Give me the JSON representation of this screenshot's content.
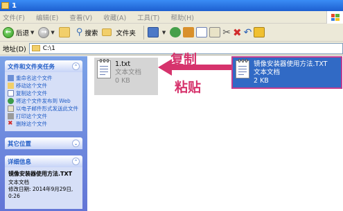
{
  "window": {
    "title": "1"
  },
  "menu": [
    "文件(F)",
    "编辑(E)",
    "查看(V)",
    "收藏(A)",
    "工具(T)",
    "帮助(H)"
  ],
  "toolbar": {
    "back_label": "后退",
    "search_label": "搜索",
    "folders_label": "文件夹"
  },
  "address": {
    "label": "地址(D)",
    "value": "C:\\1"
  },
  "left_pane": {
    "tasks_header": "文件和文件夹任务",
    "tasks": [
      "重命名这个文件",
      "移动这个文件",
      "复制这个文件",
      "将这个文件发布到 Web",
      "以电子邮件形式发送此文件",
      "打印这个文件",
      "删除这个文件"
    ],
    "other_header": "其它位置",
    "details_header": "详细信息",
    "details": {
      "name": "镜像安装器使用方法.TXT",
      "type": "文本文档",
      "modified": "修改日期: 2014年9月29日,",
      "time": "0:26"
    }
  },
  "files": [
    {
      "name": "1.txt",
      "type": "文本文档",
      "size": "0 KB"
    },
    {
      "name": "镜像安装器使用方法.TXT",
      "type": "文本文档",
      "size": "2 KB"
    }
  ],
  "annotations": {
    "copy": "复制",
    "paste": "粘贴"
  },
  "colors": {
    "annotation": "#d6336c",
    "selection": "#316ac5",
    "taskpane": "#6375d6"
  }
}
